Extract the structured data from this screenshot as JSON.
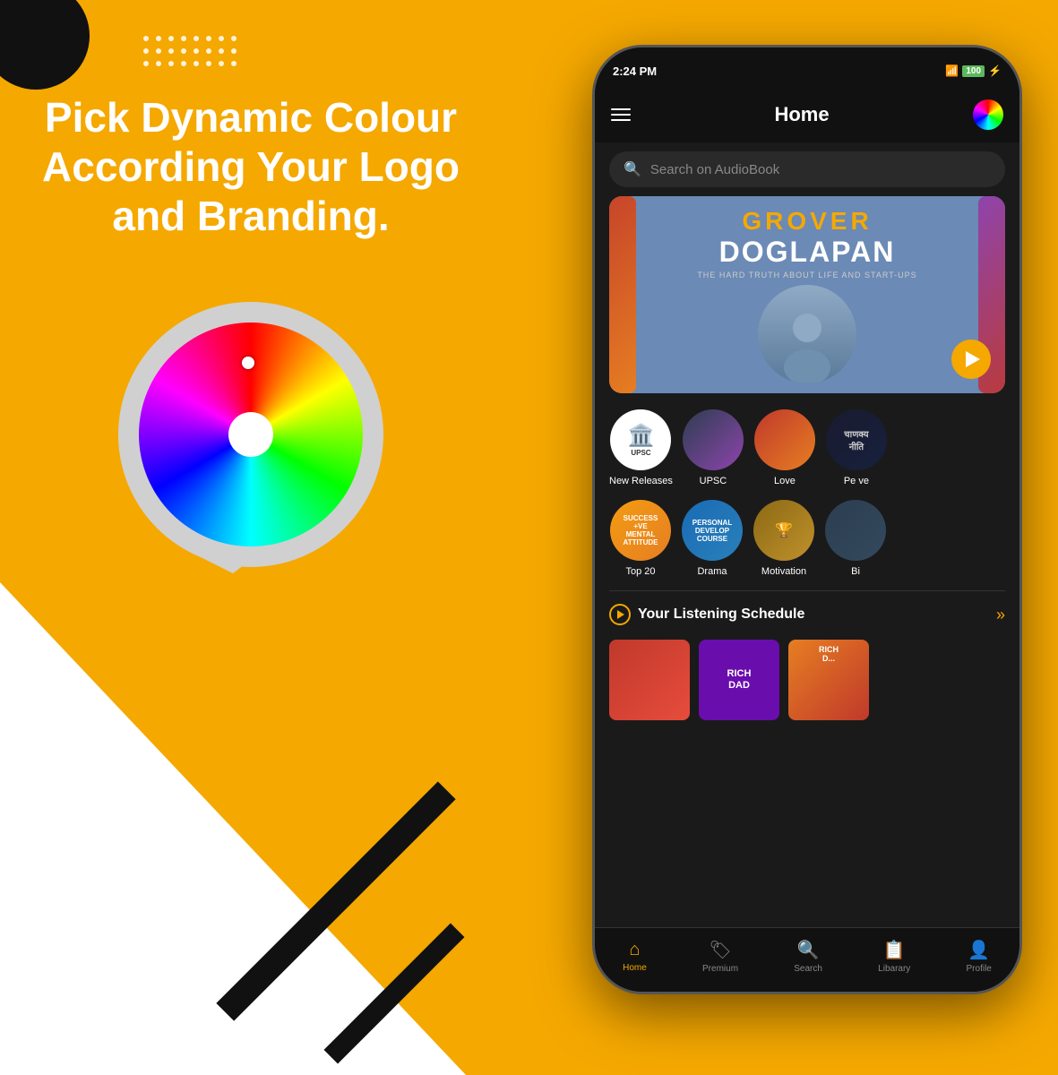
{
  "background": {
    "color": "#F5A800"
  },
  "left_panel": {
    "headline": "Pick Dynamic Colour According Your Logo and Branding.",
    "dots_rows": 3,
    "dots_per_row": 8
  },
  "phone": {
    "status_bar": {
      "time": "2:24 PM",
      "battery": "100"
    },
    "header": {
      "title": "Home",
      "menu_label": "menu",
      "color_picker_label": "color-picker"
    },
    "search": {
      "placeholder": "Search on AudioBook"
    },
    "banner": {
      "top_label": "GROVER",
      "main_title": "DOGLAPAN",
      "subtitle": "THE HARD TRUTH ABOUT LIFE AND START-UPS"
    },
    "categories_row1": [
      {
        "label": "New Releases",
        "type": "upsc"
      },
      {
        "label": "UPSC",
        "type": "image1"
      },
      {
        "label": "Love",
        "type": "image2"
      },
      {
        "label": "Pe ve",
        "type": "image3"
      }
    ],
    "categories_row2": [
      {
        "label": "Top 20",
        "type": "success"
      },
      {
        "label": "Drama",
        "type": "drama"
      },
      {
        "label": "Motivation",
        "type": "motivation"
      },
      {
        "label": "Bi",
        "type": "bio"
      }
    ],
    "schedule": {
      "title": "Your Listening Schedule",
      "chevron": "»"
    },
    "bottom_nav": [
      {
        "label": "Home",
        "icon": "⌂",
        "active": true
      },
      {
        "label": "Premium",
        "icon": "🏷",
        "active": false
      },
      {
        "label": "Search",
        "icon": "⌕",
        "active": false
      },
      {
        "label": "Libarary",
        "icon": "☰",
        "active": false
      },
      {
        "label": "Profile",
        "icon": "👤",
        "active": false
      }
    ]
  }
}
